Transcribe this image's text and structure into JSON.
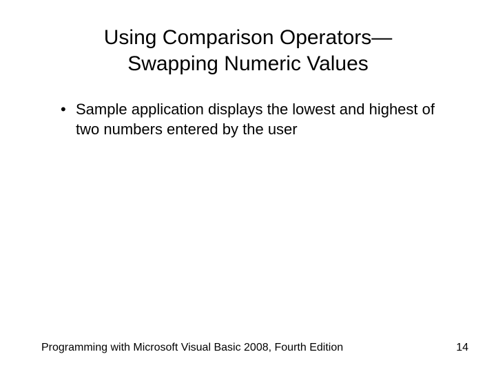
{
  "title_line1": "Using Comparison Operators—",
  "title_line2": "Swapping Numeric Values",
  "bullets": [
    "Sample application displays the lowest and highest of two numbers entered by the user"
  ],
  "footer_text": "Programming with Microsoft Visual Basic 2008, Fourth Edition",
  "page_number": "14"
}
